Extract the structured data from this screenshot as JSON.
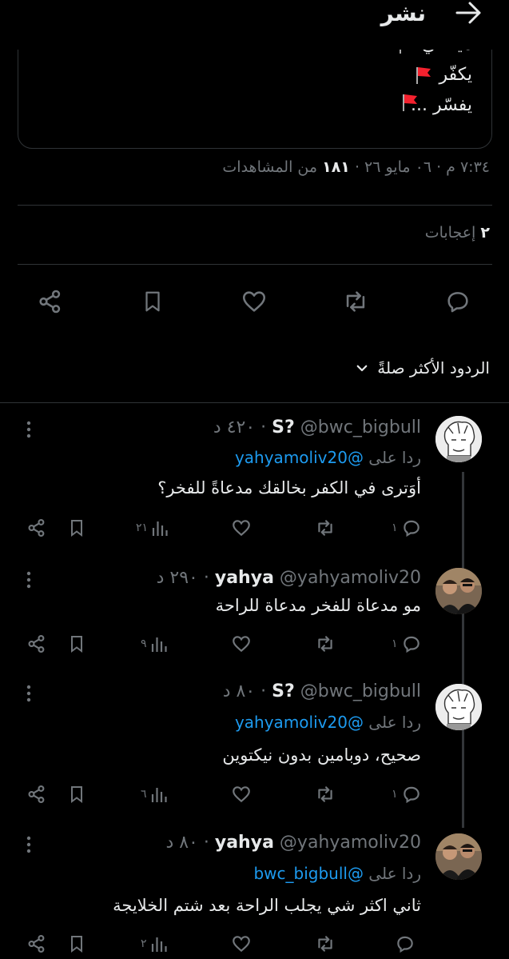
{
  "header": {
    "title": "نشر",
    "back_icon": "arrow-right-icon"
  },
  "quoted_post": {
    "lines": [
      "ميصلي",
      "يكفّر",
      "يفسّر ..."
    ],
    "flag_icon": "red-flag-icon"
  },
  "post_meta": {
    "time": "٧:٣٤ م",
    "date": "٠٦ مايو ٢٦",
    "views_count": "١٨١",
    "views_label": "من المشاهدات"
  },
  "likes": {
    "count": "٢",
    "label": "إعجابات"
  },
  "actions": {
    "reply_icon": "reply-icon",
    "repost_icon": "repost-icon",
    "like_icon": "heart-icon",
    "bookmark_icon": "bookmark-icon",
    "share_icon": "share-icon"
  },
  "replies_sort": {
    "label": "الردود الأكثر صلةً"
  },
  "replies": [
    {
      "name": "S?",
      "handle": "@bwc_bigbull",
      "time": "· ٤٢٠ د",
      "replying_to_label": "ردا على",
      "replying_to": "@yahyamoliv20",
      "text": "أوَترى في الكفر بخالقك مدعاةً للفخر؟",
      "reply_count": "١",
      "view_count": "٢١"
    },
    {
      "name": "yahya",
      "handle": "@yahyamoliv20",
      "time": "· ٢٩٠ د",
      "replying_to_label": "",
      "replying_to": "",
      "text": "مو مدعاة للفخر مدعاة للراحة",
      "reply_count": "١",
      "view_count": "٩"
    },
    {
      "name": "S?",
      "handle": "@bwc_bigbull",
      "time": "· ٨٠ د",
      "replying_to_label": "ردا على",
      "replying_to": "@yahyamoliv20",
      "text": "صحيح، دوبامين بدون نيكتوين",
      "reply_count": "١",
      "view_count": "٦"
    },
    {
      "name": "yahya",
      "handle": "@yahyamoliv20",
      "time": "· ٨٠ د",
      "replying_to_label": "ردا على",
      "replying_to": "@bwc_bigbull",
      "text": "ثاني اكثر شي يجلب الراحة بعد شتم الخلايجة",
      "reply_count": "",
      "view_count": "٢"
    }
  ],
  "colors": {
    "background": "#000000",
    "text": "#e7e9ea",
    "muted": "#71767b",
    "link": "#1d9bf0",
    "divider": "#2f3336",
    "flag": "#f4212e"
  }
}
